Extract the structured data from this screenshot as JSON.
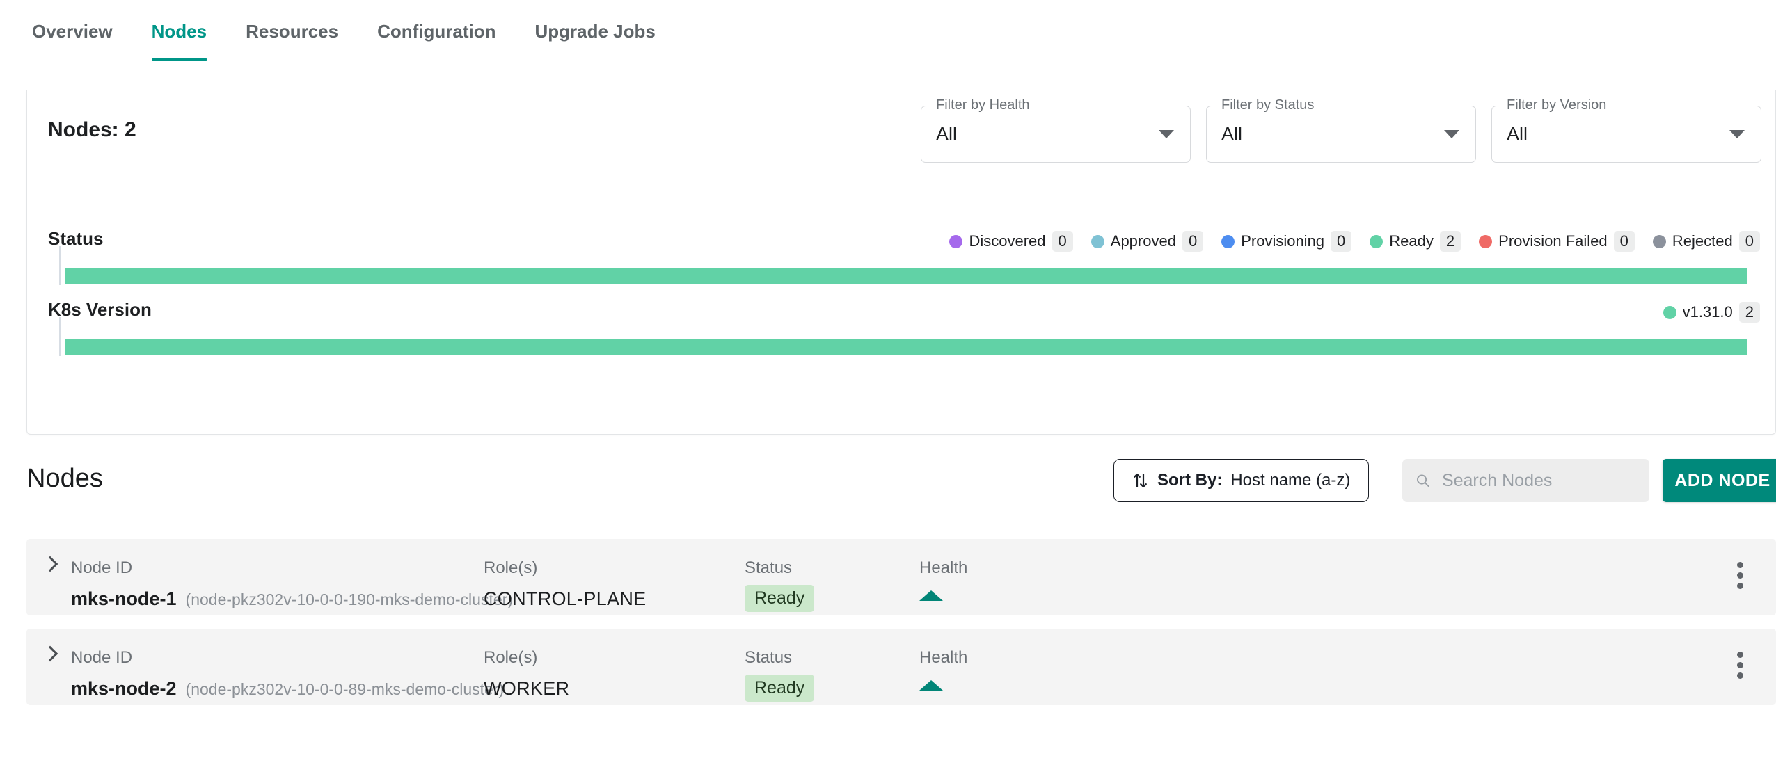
{
  "tabs": [
    {
      "label": "Overview",
      "active": false
    },
    {
      "label": "Nodes",
      "active": true
    },
    {
      "label": "Resources",
      "active": false
    },
    {
      "label": "Configuration",
      "active": false
    },
    {
      "label": "Upgrade Jobs",
      "active": false
    }
  ],
  "summary": {
    "nodes_count_label": "Nodes: 2",
    "filters": [
      {
        "label": "Filter by Health",
        "value": "All"
      },
      {
        "label": "Filter by Status",
        "value": "All"
      },
      {
        "label": "Filter by Version",
        "value": "All"
      }
    ]
  },
  "charts": {
    "status": {
      "title": "Status",
      "legend": [
        {
          "label": "Discovered",
          "count": "0",
          "color": "#a569ec"
        },
        {
          "label": "Approved",
          "count": "0",
          "color": "#7fc2d4"
        },
        {
          "label": "Provisioning",
          "count": "0",
          "color": "#4d8df0"
        },
        {
          "label": "Ready",
          "count": "2",
          "color": "#61d2a6"
        },
        {
          "label": "Provision Failed",
          "count": "0",
          "color": "#ef6a66"
        },
        {
          "label": "Rejected",
          "count": "0",
          "color": "#8b919c"
        }
      ]
    },
    "version": {
      "title": "K8s Version",
      "legend": [
        {
          "label": "v1.31.0",
          "count": "2",
          "color": "#61d2a6"
        }
      ]
    }
  },
  "chart_data": [
    {
      "type": "bar",
      "title": "Status",
      "orientation": "horizontal",
      "stacked": true,
      "categories": [
        "Discovered",
        "Approved",
        "Provisioning",
        "Ready",
        "Provision Failed",
        "Rejected"
      ],
      "values": [
        0,
        0,
        0,
        2,
        0,
        0
      ],
      "colors": [
        "#a569ec",
        "#7fc2d4",
        "#4d8df0",
        "#61d2a6",
        "#ef6a66",
        "#8b919c"
      ],
      "total": 2,
      "xlabel": "",
      "ylabel": "",
      "grid": false,
      "legend_position": "top-right"
    },
    {
      "type": "bar",
      "title": "K8s Version",
      "orientation": "horizontal",
      "stacked": true,
      "categories": [
        "v1.31.0"
      ],
      "values": [
        2
      ],
      "colors": [
        "#61d2a6"
      ],
      "total": 2,
      "xlabel": "",
      "ylabel": "",
      "grid": false,
      "legend_position": "top-right"
    }
  ],
  "nodes_section": {
    "heading": "Nodes",
    "sort": {
      "label": "Sort By:",
      "value": "Host name (a-z)"
    },
    "search_placeholder": "Search Nodes",
    "search_value": "",
    "add_button": "ADD NODE",
    "columns": {
      "node_id": "Node ID",
      "roles": "Role(s)",
      "status": "Status",
      "health": "Health"
    },
    "rows": [
      {
        "hostname": "mks-node-1",
        "fqdn": "(node-pkz302v-10-0-0-190-mks-demo-cluster)",
        "role": "CONTROL-PLANE",
        "status": "Ready",
        "health": "healthy"
      },
      {
        "hostname": "mks-node-2",
        "fqdn": "(node-pkz302v-10-0-0-89-mks-demo-cluster)",
        "role": "WORKER",
        "status": "Ready",
        "health": "healthy"
      }
    ]
  }
}
